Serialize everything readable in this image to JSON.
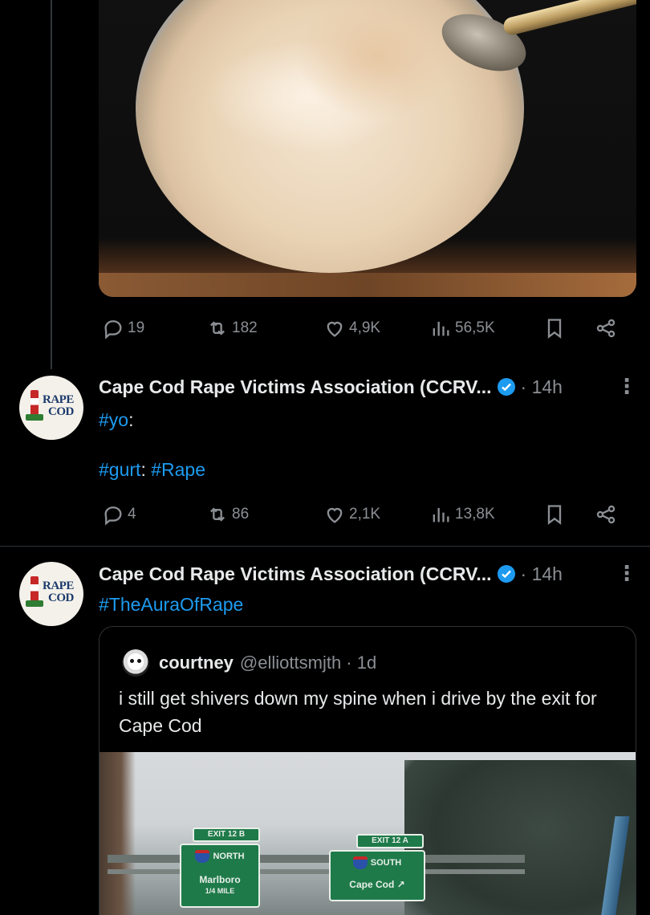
{
  "top_tweet": {
    "actions": {
      "replies": "19",
      "reposts": "182",
      "likes": "4,9K",
      "views": "56,5K"
    }
  },
  "tweet2": {
    "author": "Cape Cod Rape Victims Association (CCRV...",
    "time": "· 14h",
    "avatar_text": [
      "RAPE",
      "COD"
    ],
    "line1": {
      "hashtag": "#yo",
      "suffix": ":"
    },
    "line2": {
      "hashtag1": "#gurt",
      "sep": ": ",
      "hashtag2": "#Rape"
    },
    "actions": {
      "replies": "4",
      "reposts": "86",
      "likes": "2,1K",
      "views": "13,8K"
    }
  },
  "tweet3": {
    "author": "Cape Cod Rape Victims Association (CCRV...",
    "time": "· 14h",
    "avatar_text": [
      "RAPE",
      "COD"
    ],
    "hashtag": "#TheAuraOfRape",
    "quote": {
      "name": "courtney",
      "handle": "@elliottsmjth · 1d",
      "text": "i still get shivers down my spine when i drive by the exit for Cape Cod",
      "signs": {
        "left_exit": "EXIT 12 B",
        "left_dir": "NORTH",
        "left_dest": "Marlboro",
        "left_sub": "1/4 MILE",
        "right_exit": "EXIT 12 A",
        "right_dir": "SOUTH",
        "right_dest": "Cape Cod ↗"
      }
    }
  },
  "more_glyph": "⋮",
  "colors": {
    "link": "#1d9bf0",
    "muted": "#8b8f94",
    "verified": "#1d9bf0"
  }
}
